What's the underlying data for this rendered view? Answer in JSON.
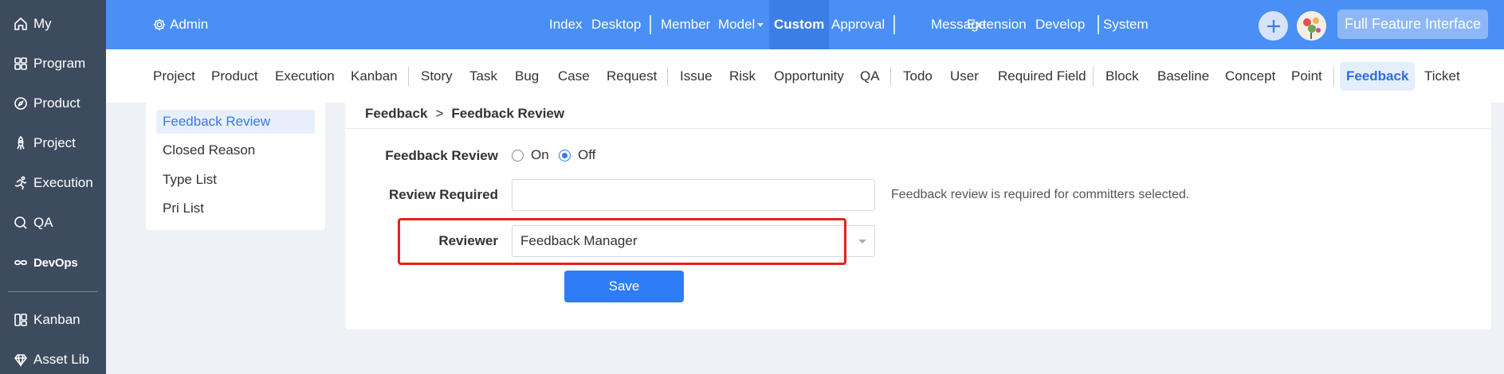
{
  "sidebar": {
    "items": [
      {
        "label": "My",
        "icon": "home-icon"
      },
      {
        "label": "Program",
        "icon": "grid-icon"
      },
      {
        "label": "Product",
        "icon": "compass-icon"
      },
      {
        "label": "Project",
        "icon": "rocket-icon"
      },
      {
        "label": "Execution",
        "icon": "runner-icon"
      },
      {
        "label": "QA",
        "icon": "search-bug-icon"
      },
      {
        "label": "DevOps",
        "icon": "infinity-icon"
      },
      {
        "label": "Kanban",
        "icon": "kanban-icon"
      },
      {
        "label": "Asset Lib",
        "icon": "diamond-icon"
      }
    ]
  },
  "header": {
    "admin_label": "Admin",
    "nav": [
      "Index",
      "Desktop",
      "Member",
      "Model",
      "Custom",
      "Approval",
      "Message",
      "Extension",
      "Develop",
      "System"
    ],
    "active_nav": "Custom",
    "full_feature_label": "Full Feature Interface",
    "accent_color": "#4a8ff5"
  },
  "subnav": {
    "items": [
      "Project",
      "Product",
      "Execution",
      "Kanban",
      "Story",
      "Task",
      "Bug",
      "Case",
      "Request",
      "Issue",
      "Risk",
      "Opportunity",
      "QA",
      "Todo",
      "User",
      "Required Field",
      "Block",
      "Baseline",
      "Concept",
      "Point",
      "Feedback",
      "Ticket"
    ],
    "active": "Feedback"
  },
  "side_menu": {
    "items": [
      "Feedback Review",
      "Closed Reason",
      "Type List",
      "Pri List"
    ],
    "active": "Feedback Review"
  },
  "breadcrumb": {
    "parent": "Feedback",
    "separator": ">",
    "current": "Feedback Review"
  },
  "form": {
    "feedback_review_label": "Feedback Review",
    "option_on": "On",
    "option_off": "Off",
    "selected_option": "Off",
    "review_required_label": "Review Required",
    "review_required_value": "",
    "review_required_hint": "Feedback review is required for committers selected.",
    "reviewer_label": "Reviewer",
    "reviewer_value": "Feedback Manager",
    "save_label": "Save"
  }
}
